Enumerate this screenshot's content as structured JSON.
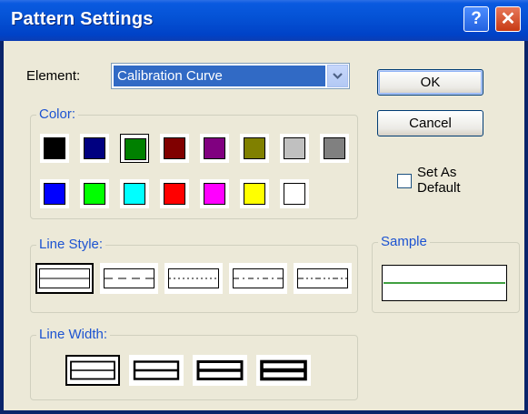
{
  "window": {
    "title": "Pattern Settings",
    "help_glyph": "?",
    "close_glyph": "✕"
  },
  "element": {
    "label": "Element:",
    "selected": "Calibration Curve"
  },
  "color_group": {
    "title": "Color:",
    "swatches": [
      "#000000",
      "#000080",
      "#008000",
      "#800000",
      "#800080",
      "#808000",
      "#c0c0c0",
      "#808080",
      "#0000ff",
      "#00ff00",
      "#00ffff",
      "#ff0000",
      "#ff00ff",
      "#ffff00",
      "#ffffff"
    ],
    "selected_index": 2
  },
  "line_style_group": {
    "title": "Line Style:",
    "styles": [
      "solid",
      "dash",
      "dot",
      "dash-dot",
      "dash-dot-dot"
    ],
    "selected_index": 0
  },
  "line_width_group": {
    "title": "Line Width:",
    "widths": [
      1,
      2,
      3,
      4
    ],
    "selected_index": 0
  },
  "buttons": {
    "ok": "OK",
    "cancel": "Cancel"
  },
  "set_default": {
    "line1": "Set As",
    "line2": "Default",
    "checked": false
  },
  "sample": {
    "title": "Sample",
    "line_color": "#008000"
  }
}
